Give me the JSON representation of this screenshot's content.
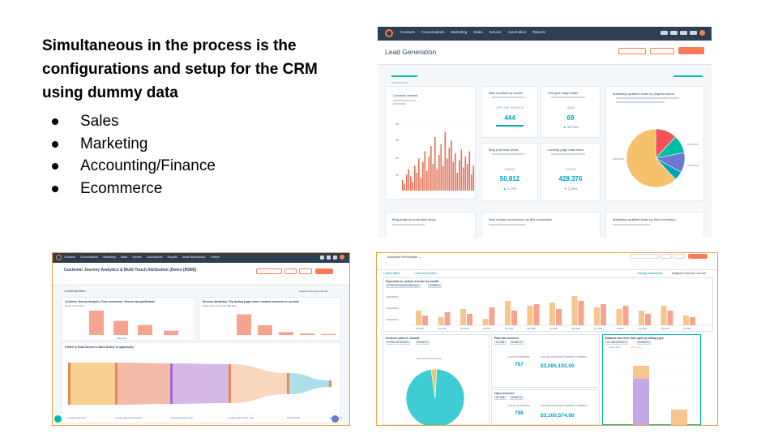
{
  "slide": {
    "heading": "Simultaneous in the process is the configurations and setup for the CRM using dummy data",
    "bullets": [
      "Sales",
      "Marketing",
      "Accounting/Finance",
      "Ecommerce"
    ]
  },
  "lead_generation": {
    "nav": [
      "Contacts",
      "Conversations",
      "Marketing",
      "Sales",
      "Service",
      "Automation",
      "Reports"
    ],
    "title": "Lead Generation",
    "cards": {
      "contacts_created": "Contacts created",
      "y_ticks": [
        "40",
        "30",
        "20",
        "10"
      ],
      "new_contacts": {
        "title": "New contacts by source",
        "label": "OFFLINE SOURCE",
        "value": "444"
      },
      "lifecycle": {
        "title": "Lifecycle stage totals",
        "label": "LEAD",
        "value": "69",
        "delta": "45.73%"
      },
      "blog_views": {
        "title": "Blog post total views",
        "label": "VIEWS",
        "value": "50,812",
        "delta": "1.17%"
      },
      "landing_views": {
        "title": "Landing page total views",
        "label": "VIEWS",
        "value": "428,376",
        "delta": "2.16%"
      },
      "mql": {
        "title": "Marketing qualified leads by original source"
      },
      "blog_most": "Blog posts by most total views",
      "conversions": "New contact conversions by first conversion",
      "mql_first": "Marketing qualified leads by first conversion"
    },
    "bars": [
      6,
      4,
      9,
      12,
      8,
      5,
      14,
      10,
      18,
      7,
      16,
      22,
      11,
      19,
      25,
      15,
      30,
      12,
      20,
      26,
      14,
      33,
      18,
      24,
      28,
      16,
      21,
      10,
      17,
      23,
      13,
      19,
      15,
      22,
      9,
      14
    ],
    "pie": [
      {
        "value": 12,
        "color": "#f2545b"
      },
      {
        "value": 10,
        "color": "#00bda5"
      },
      {
        "value": 11,
        "color": "#6a78d1"
      },
      {
        "value": 5,
        "color": "#00a4bd"
      },
      {
        "value": 62,
        "color": "#f5c26b"
      }
    ]
  },
  "attribution": {
    "nav": [
      "Contacts",
      "Conversations",
      "Marketing",
      "Sales",
      "Service",
      "Automations",
      "Reports",
      "Asset Marketplace",
      "Partner"
    ],
    "title": "Customer Journey Analytics & Multi-Touch Attribution (Demo (RDM))",
    "filters_label": "Dashboard filters",
    "assigned": "Assigned: Everyone can edit",
    "panel1": {
      "title": "Customer Journey Analytics: Form conversion: View-to-lead qualification",
      "sub": "Count of Contacts",
      "bars": [
        100,
        58,
        41,
        18
      ],
      "xlabel": "Stage Tag"
    },
    "panel2": {
      "title": "Revenue Attribution: Top landing pages where contacts converted on our form",
      "sub": "Page views in the last 365 days",
      "bars": [
        85,
        40,
        12,
        6,
        4
      ]
    },
    "panel3": {
      "title": "8 Week to Email Nurture to Sales Nurture to Opportunity",
      "stages": [
        "Landing Page Visit",
        "Landing page form submitted",
        "Capped reviewing email",
        "Engaged with pricing email",
        "Reached SQL",
        "Opportunity created"
      ],
      "colors": [
        "#f5c26b",
        "#f2a48c",
        "#c7a0e0",
        "#f7c9a8",
        "#8fd4e6",
        "#6bc6e3"
      ]
    }
  },
  "accounts_receivable": {
    "title": "Accounts Receivable",
    "quick_filters": "Quick filters",
    "advanced": "Advanced filters",
    "manage": "Manage dashboards",
    "assigned": "Assigned: Everyone can edit",
    "top_panel": {
      "title": "Expected vs. actual revenue by month",
      "tags": [
        "IN THE LAST 365 DAYS (ROLLING)",
        "FILTERS (1)"
      ],
      "y_ticks": [
        "$300,000.00",
        "$200,000.00",
        "$100,000.00"
      ],
      "bars": [
        {
          "label": "Oct 2022",
          "a": 18,
          "b": 12
        },
        {
          "label": "Nov 2022",
          "a": 10,
          "b": 16
        },
        {
          "label": "Dec 2022",
          "a": 20,
          "b": 14
        },
        {
          "label": "Jan 2023",
          "a": 8,
          "b": 22
        },
        {
          "label": "Feb 2023",
          "a": 30,
          "b": 18
        },
        {
          "label": "Mar 2023",
          "a": 24,
          "b": 26
        },
        {
          "label": "Apr 2023",
          "a": 28,
          "b": 20
        },
        {
          "label": "May 2023",
          "a": 36,
          "b": 30
        },
        {
          "label": "Jun 2023",
          "a": 22,
          "b": 26
        },
        {
          "label": "Jul 2023",
          "a": 20,
          "b": 24
        },
        {
          "label": "Aug 2023",
          "a": 18,
          "b": 14
        },
        {
          "label": "Sep 2023",
          "a": 24,
          "b": 18
        },
        {
          "label": "Oct 2023",
          "a": 12,
          "b": 10
        }
      ]
    },
    "invoices": {
      "title": "Invoices paid vs. Issued",
      "tags": [
        "IN THE LAST 365 DAYS",
        "FILTERS (1)"
      ],
      "caption": "Total Count of Invoices (14)",
      "pie": [
        {
          "value": 97,
          "color": "#3ecdd4"
        },
        {
          "value": 3,
          "color": "#f5c26b"
        }
      ]
    },
    "past_due": {
      "title": "Past due invoices",
      "tags": [
        "ALL TIME",
        "FILTERS (1)"
      ],
      "count_label": "COUNT OF INVOICES",
      "count": "767",
      "balance_label": "SUM: BALANCE DUE IN COMPANY CURRENCY",
      "balance": "$3,085,193.00"
    },
    "open": {
      "title": "Open invoices",
      "tags": [
        "ALL TIME",
        "FILTERS (1)"
      ],
      "count_label": "COUNT OF INVOICES",
      "count": "798",
      "balance_label": "SUM: BALANCE DUE IN COMPANY CURRENCY",
      "balance": "$3,100,574.80"
    },
    "balance_panel": {
      "title": "Balance due over time split by billing type",
      "tags": [
        "ALL TIME (MONTHLY)",
        "FILTERS (1)"
      ],
      "legend": [
        "One-time",
        "Recurring"
      ]
    }
  }
}
